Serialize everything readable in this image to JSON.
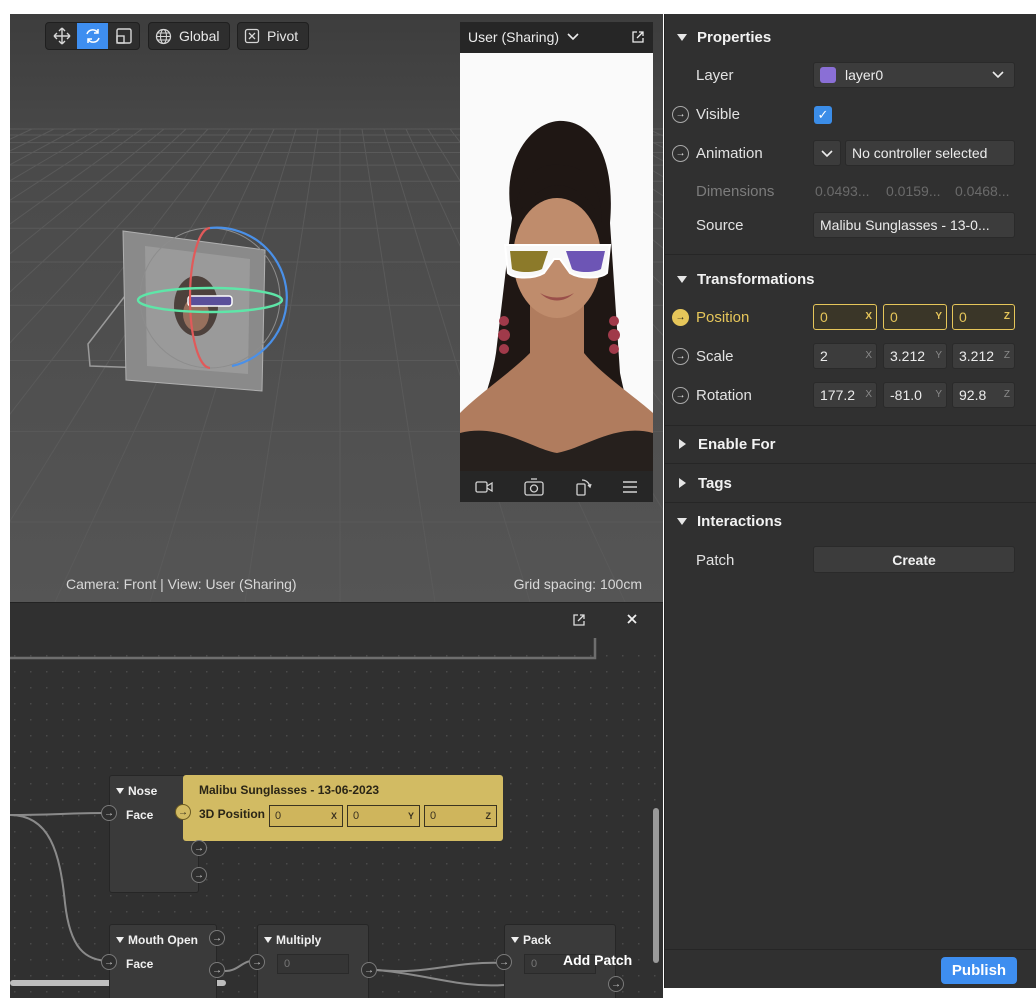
{
  "viewport": {
    "toolbar": {
      "move_tool": "move-tool",
      "rotate_tool": "rotate-tool",
      "scale_tool": "scale-tool",
      "global_label": "Global",
      "pivot_label": "Pivot"
    },
    "status_left": "Camera: Front | View: User (Sharing)",
    "status_right": "Grid spacing: 100cm"
  },
  "simulator": {
    "device_label": "User (Sharing)",
    "icons": [
      "video-camera-icon",
      "switch-camera-icon",
      "rotate-device-icon",
      "menu-icon"
    ]
  },
  "patch_editor": {
    "nodes": {
      "nose": {
        "title": "Nose",
        "port": "Face"
      },
      "sunglasses": {
        "title": "Malibu Sunglasses - 13-06-2023",
        "port": "3D Position",
        "x": "0",
        "y": "0",
        "z": "0",
        "x_axis": "X",
        "y_axis": "Y",
        "z_axis": "Z"
      },
      "mouth_open": {
        "title": "Mouth Open",
        "port": "Face"
      },
      "multiply": {
        "title": "Multiply",
        "value": "0"
      },
      "pack": {
        "title": "Pack",
        "value": "0"
      }
    },
    "add_patch_label": "Add Patch"
  },
  "inspector": {
    "properties": {
      "title": "Properties",
      "layer_label": "Layer",
      "layer_value": "layer0",
      "layer_color": "#8a6fd6",
      "visible_label": "Visible",
      "visible_checked": true,
      "animation_label": "Animation",
      "animation_value": "No controller selected",
      "dimensions_label": "Dimensions",
      "dimensions": [
        "0.0493...",
        "0.0159...",
        "0.0468..."
      ],
      "source_label": "Source",
      "source_value": "Malibu Sunglasses - 13-0..."
    },
    "transformations": {
      "title": "Transformations",
      "position_label": "Position",
      "position": [
        "0",
        "0",
        "0"
      ],
      "scale_label": "Scale",
      "scale": [
        "2",
        "3.212",
        "3.212"
      ],
      "rotation_label": "Rotation",
      "rotation": [
        "177.2",
        "-81.0",
        "92.8"
      ],
      "axes": [
        "X",
        "Y",
        "Z"
      ]
    },
    "enable_for": {
      "title": "Enable For"
    },
    "tags": {
      "title": "Tags"
    },
    "interactions": {
      "title": "Interactions",
      "patch_label": "Patch",
      "create_label": "Create"
    },
    "publish_label": "Publish"
  },
  "colors": {
    "accent": "#3e8ef0",
    "gold": "#e6c65a",
    "patch_gold": "#d2bb63"
  }
}
